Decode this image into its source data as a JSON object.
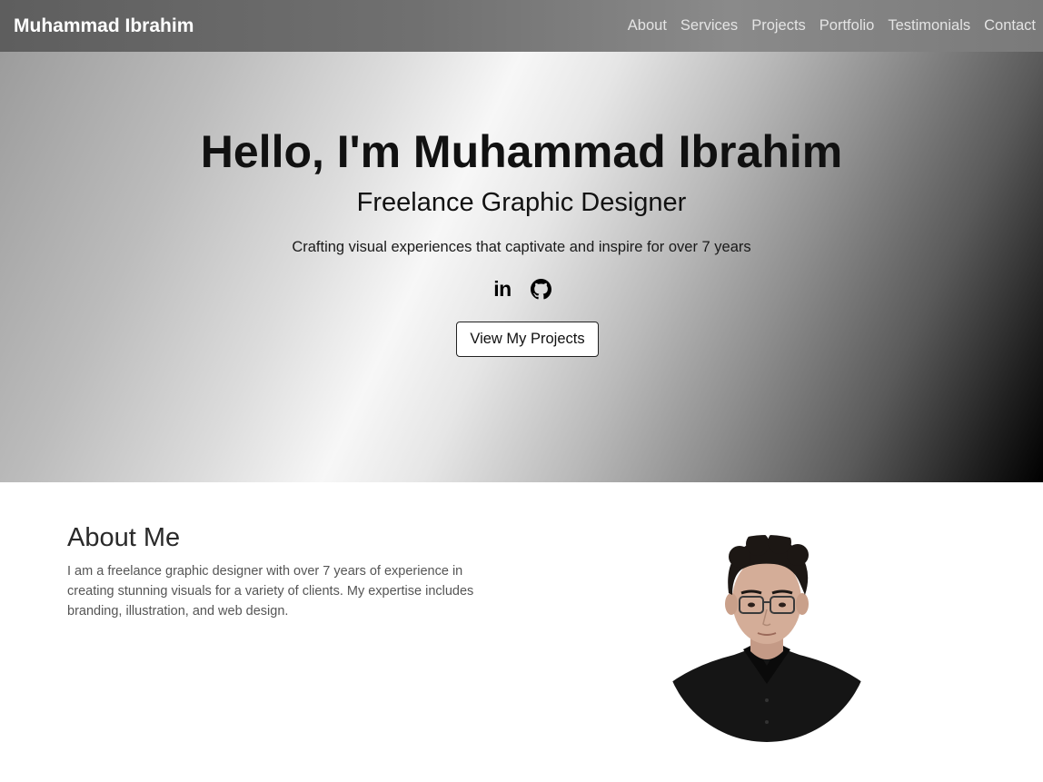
{
  "nav": {
    "brand": "Muhammad Ibrahim",
    "links": [
      "About",
      "Services",
      "Projects",
      "Portfolio",
      "Testimonials",
      "Contact"
    ]
  },
  "hero": {
    "title": "Hello, I'm Muhammad Ibrahim",
    "subtitle": "Freelance Graphic Designer",
    "tagline": "Crafting visual experiences that captivate and inspire for over 7 years",
    "social": {
      "linkedin_glyph": "in",
      "icons": [
        "linkedin-icon",
        "github-icon"
      ]
    },
    "cta_label": "View My Projects"
  },
  "about": {
    "title": "About Me",
    "text": "I am a freelance graphic designer with over 7 years of experience in creating stunning visuals for a variety of clients. My expertise includes branding, illustration, and web design."
  },
  "colors": {
    "navbar": "#6e6e6e",
    "nav_text": "#e4e4e4",
    "brand_text": "#ffffff",
    "hero_dark": "#000000",
    "hero_light": "#f7f7f7"
  }
}
